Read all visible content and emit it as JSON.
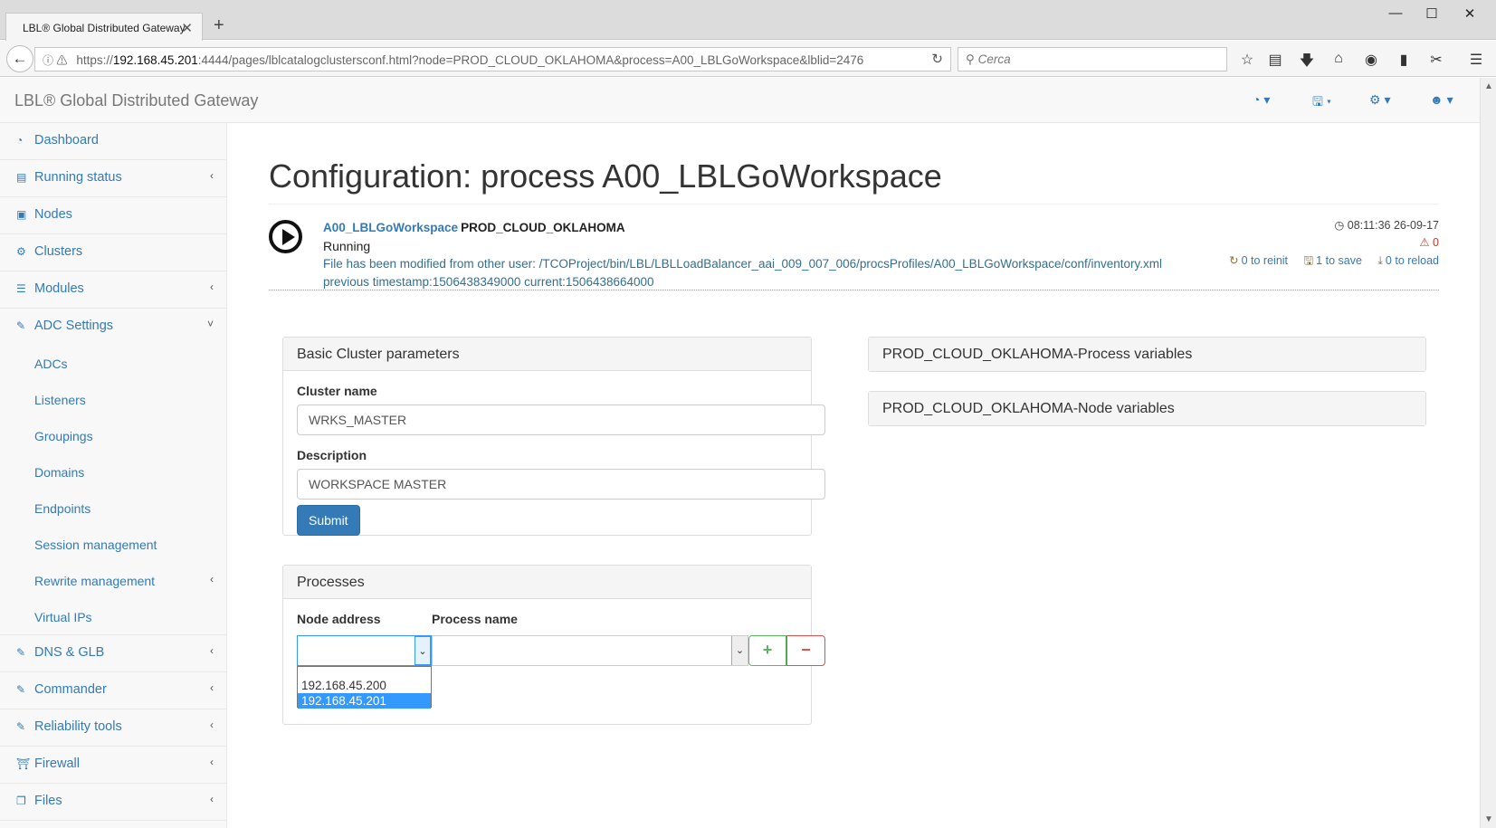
{
  "browser": {
    "tab_title": "LBL® Global Distributed Gateway",
    "tab_close": "✕",
    "new_tab": "+",
    "url_prefix": "https://",
    "url_host": "192.168.45.201",
    "url_rest": ":4444/pages/lblcatalogclustersconf.html?node=PROD_CLOUD_OKLAHOMA&process=A00_LBLGoWorkspace&lblid=2476",
    "search_placeholder": "Cerca",
    "window_controls": [
      "—",
      "☐",
      "✕"
    ],
    "toolbar_icons": [
      "bookmark-star-icon",
      "reading-list-icon",
      "download-icon",
      "home-icon",
      "pocket-icon",
      "library-icon",
      "screenshot-icon",
      "menu-icon"
    ]
  },
  "app": {
    "brand": "LBL® Global Distributed Gateway",
    "header_menus": [
      "dashboard-menu",
      "save-menu",
      "settings-menu",
      "user-menu"
    ]
  },
  "sidebar": {
    "items": [
      {
        "label": "Dashboard",
        "icon": "dashboard-icon",
        "chevron": ""
      },
      {
        "label": "Running status",
        "icon": "bar-chart-icon",
        "chevron": "‹"
      },
      {
        "label": "Nodes",
        "icon": "cube-icon",
        "chevron": ""
      },
      {
        "label": "Clusters",
        "icon": "cogs-icon",
        "chevron": ""
      },
      {
        "label": "Modules",
        "icon": "list-icon",
        "chevron": "‹"
      },
      {
        "label": "ADC Settings",
        "icon": "edit-icon",
        "chevron": "˅"
      }
    ],
    "sub_items": [
      {
        "label": "ADCs",
        "chevron": ""
      },
      {
        "label": "Listeners",
        "chevron": ""
      },
      {
        "label": "Groupings",
        "chevron": ""
      },
      {
        "label": "Domains",
        "chevron": ""
      },
      {
        "label": "Endpoints",
        "chevron": ""
      },
      {
        "label": "Session management",
        "chevron": ""
      },
      {
        "label": "Rewrite management",
        "chevron": "‹"
      },
      {
        "label": "Virtual IPs",
        "chevron": ""
      }
    ],
    "bottom_items": [
      {
        "label": "DNS & GLB",
        "icon": "edit-icon",
        "chevron": "‹"
      },
      {
        "label": "Commander",
        "icon": "edit-icon",
        "chevron": "‹"
      },
      {
        "label": "Reliability tools",
        "icon": "edit-icon",
        "chevron": "‹"
      },
      {
        "label": "Firewall",
        "icon": "shield-icon",
        "chevron": "‹"
      },
      {
        "label": "Files",
        "icon": "files-icon",
        "chevron": "‹"
      }
    ]
  },
  "main": {
    "title": "Configuration: process A00_LBLGoWorkspace",
    "status": {
      "process": "A00_LBLGoWorkspace",
      "node": "PROD_CLOUD_OKLAHOMA",
      "state": "Running",
      "warning": "File has been modified from other user: /TCOProject/bin/LBL/LBLLoadBalancer_aai_009_007_006/procsProfiles/A00_LBLGoWorkspace/conf/inventory.xml",
      "timestamps": "previous timestamp:1506438349000 current:1506438664000",
      "datetime": "08:11:36 26-09-17",
      "alerts": "0",
      "reinit": "0 to reinit",
      "save": "1 to save",
      "reload": "0 to reload"
    },
    "basic_panel": {
      "heading": "Basic Cluster parameters",
      "cluster_name_label": "Cluster name",
      "cluster_name_value": "WRKS_MASTER",
      "description_label": "Description",
      "description_value": "WORKSPACE MASTER",
      "submit": "Submit"
    },
    "processes_panel": {
      "heading": "Processes",
      "node_label": "Node address",
      "process_label": "Process name",
      "node_options": [
        "192.168.45.200",
        "192.168.45.201"
      ],
      "add": "+",
      "remove": "−"
    },
    "process_vars_heading": "PROD_CLOUD_OKLAHOMA-Process variables",
    "node_vars_heading": "PROD_CLOUD_OKLAHOMA-Node variables"
  }
}
